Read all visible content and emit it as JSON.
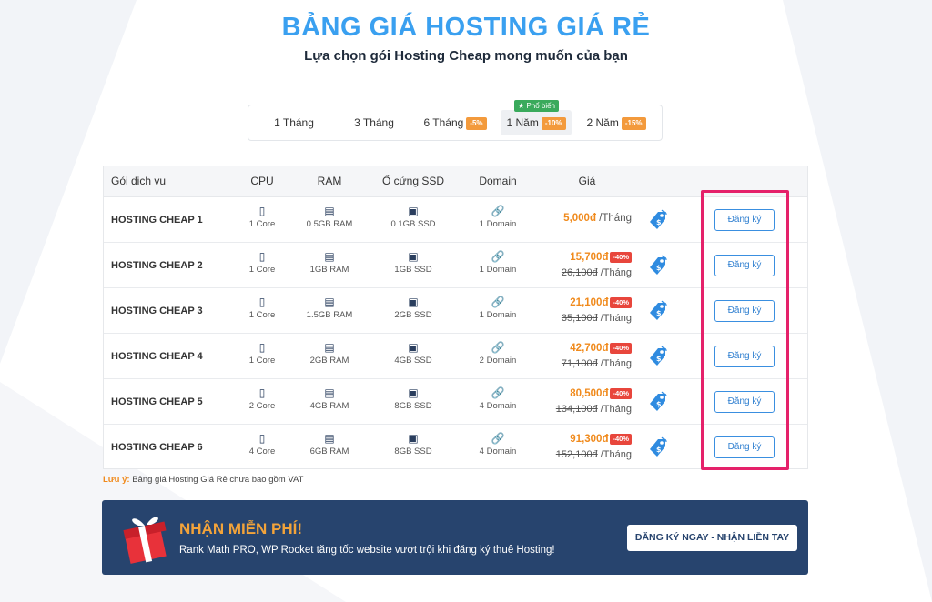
{
  "header": {
    "title": "BẢNG GIÁ HOSTING GIÁ RẺ",
    "subtitle": "Lựa chọn gói Hosting Cheap mong muốn của bạn"
  },
  "period_tabs": {
    "popular_badge": "Phổ biến",
    "items": [
      {
        "label": "1 Tháng",
        "discount": ""
      },
      {
        "label": "3 Tháng",
        "discount": ""
      },
      {
        "label": "6 Tháng",
        "discount": "-5%"
      },
      {
        "label": "1 Năm",
        "discount": "-10%",
        "active": true
      },
      {
        "label": "2 Năm",
        "discount": "-15%"
      }
    ]
  },
  "table": {
    "headers": {
      "service": "Gói dịch vụ",
      "cpu": "CPU",
      "ram": "RAM",
      "ssd": "Ổ cứng SSD",
      "domain": "Domain",
      "price": "Giá"
    },
    "rows": [
      {
        "name": "HOSTING CHEAP 1",
        "cpu": "1 Core",
        "ram": "0.5GB RAM",
        "ssd": "0.1GB SSD",
        "domain": "1 Domain",
        "price": "5,000đ",
        "per": "/Tháng",
        "discount": "",
        "old_price": "",
        "button": "Đăng ký"
      },
      {
        "name": "HOSTING CHEAP 2",
        "cpu": "1 Core",
        "ram": "1GB RAM",
        "ssd": "1GB SSD",
        "domain": "1 Domain",
        "price": "15,700đ",
        "per": "/Tháng",
        "discount": "-40%",
        "old_price": "26,100đ",
        "button": "Đăng ký"
      },
      {
        "name": "HOSTING CHEAP 3",
        "cpu": "1 Core",
        "ram": "1.5GB RAM",
        "ssd": "2GB SSD",
        "domain": "1 Domain",
        "price": "21,100đ",
        "per": "/Tháng",
        "discount": "-40%",
        "old_price": "35,100đ",
        "button": "Đăng ký"
      },
      {
        "name": "HOSTING CHEAP 4",
        "cpu": "1 Core",
        "ram": "2GB RAM",
        "ssd": "4GB SSD",
        "domain": "2 Domain",
        "price": "42,700đ",
        "per": "/Tháng",
        "discount": "-40%",
        "old_price": "71,100đ",
        "button": "Đăng ký"
      },
      {
        "name": "HOSTING CHEAP 5",
        "cpu": "2 Core",
        "ram": "4GB RAM",
        "ssd": "8GB SSD",
        "domain": "4 Domain",
        "price": "80,500đ",
        "per": "/Tháng",
        "discount": "-40%",
        "old_price": "134,100đ",
        "button": "Đăng ký"
      },
      {
        "name": "HOSTING CHEAP 6",
        "cpu": "4 Core",
        "ram": "6GB RAM",
        "ssd": "8GB SSD",
        "domain": "4 Domain",
        "price": "91,300đ",
        "per": "/Tháng",
        "discount": "-40%",
        "old_price": "152,100đ",
        "button": "Đăng ký"
      }
    ]
  },
  "note": {
    "label": "Lưu ý:",
    "text": "Bảng giá Hosting Giá Rẻ chưa bao gồm VAT"
  },
  "promo": {
    "title": "NHẬN MIỄN PHÍ!",
    "description": "Rank Math PRO, WP Rocket tăng tốc website vượt trội khi đăng ký thuê Hosting!",
    "button": "ĐĂNG KÝ NGAY - NHẬN LIỀN TAY"
  },
  "colors": {
    "title": "#3aa0f0",
    "price": "#f08a1c",
    "discount": "#e8463c",
    "highlight": "#e5216a",
    "promo_bg": "#27446e"
  },
  "icons": {
    "cpu": "chip-icon",
    "ram": "memory-icon",
    "ssd": "hdd-icon",
    "domain": "link-icon",
    "price_tag": "price-tag-icon",
    "gift": "gift-icon",
    "popular": "star-icon"
  }
}
